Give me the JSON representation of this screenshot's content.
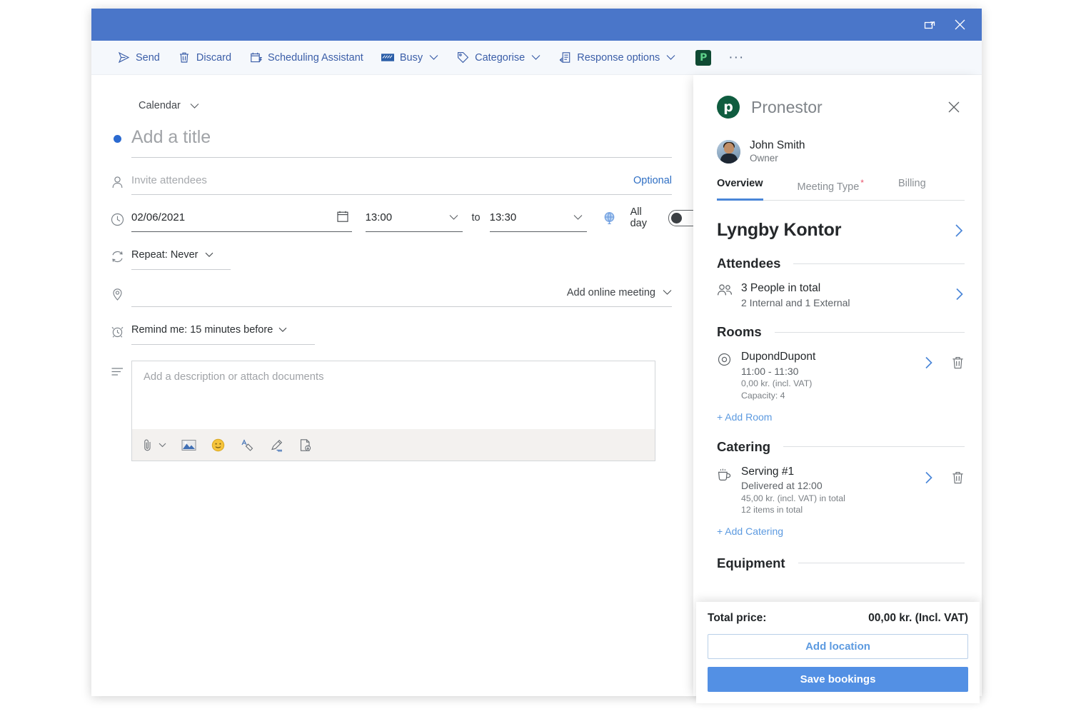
{
  "window": {
    "titlebar": {
      "popout_icon": "popout-icon",
      "close_icon": "close-icon"
    },
    "toolbar": {
      "items": [
        {
          "label": "Send",
          "icon": "send-icon",
          "chevron": false
        },
        {
          "label": "Discard",
          "icon": "trash-icon",
          "chevron": false
        },
        {
          "label": "Scheduling Assistant",
          "icon": "calendar-assistant-icon",
          "chevron": false
        },
        {
          "label": "Busy",
          "icon": "busy-icon",
          "chevron": true
        },
        {
          "label": "Categorise",
          "icon": "tag-icon",
          "chevron": true
        },
        {
          "label": "Response options",
          "icon": "response-options-icon",
          "chevron": true
        }
      ],
      "pronestor_badge": "P",
      "overflow": "···"
    }
  },
  "form": {
    "calendar_select": "Calendar",
    "title_placeholder": "Add a title",
    "attendees_placeholder": "Invite attendees",
    "optional_label": "Optional",
    "date_value": "02/06/2021",
    "start_time": "13:00",
    "to_label": "to",
    "end_time": "13:30",
    "all_day_label": "All day",
    "repeat_label": "Repeat:  Never",
    "online_meeting_label": "Add online meeting",
    "remind_label": "Remind me:  15 minutes before",
    "description_placeholder": "Add a description or attach documents",
    "desc_toolbar_icons": [
      "attach-icon",
      "insert-picture-icon",
      "emoji-icon",
      "signature-icon",
      "ink-icon",
      "export-icon"
    ]
  },
  "panel": {
    "brand_name": "Pronestor",
    "brand_initial": "p",
    "close_icon": "close-icon",
    "user": {
      "name": "John Smith",
      "role": "Owner"
    },
    "tabs": [
      {
        "label": "Overview",
        "active": true,
        "required": false
      },
      {
        "label": "Meeting Type",
        "active": false,
        "required": true
      },
      {
        "label": "Billing",
        "active": false,
        "required": false
      }
    ],
    "location_title": "Lyngby Kontor",
    "sections": {
      "attendees": {
        "heading": "Attendees",
        "item": {
          "line1": "3 People in total",
          "line2": "2 Internal and 1 External"
        }
      },
      "rooms": {
        "heading": "Rooms",
        "item": {
          "line1": "DupondDupont",
          "line2": "11:00 - 11:30",
          "line3": "0,00 kr. (incl. VAT)",
          "line4": "Capacity: 4"
        },
        "add_link": "+ Add Room"
      },
      "catering": {
        "heading": "Catering",
        "item": {
          "line1": "Serving #1",
          "line2": "Delivered at 12:00",
          "line3": "45,00 kr. (incl. VAT) in total",
          "line4": "12 items in total"
        },
        "add_link": "+ Add Catering"
      },
      "equipment": {
        "heading": "Equipment"
      }
    }
  },
  "footer": {
    "total_label": "Total price:",
    "total_value": "00,00 kr. (Incl. VAT)",
    "add_location_label": "Add location",
    "save_bookings_label": "Save bookings"
  },
  "colors": {
    "titlebar_blue": "#4a76c9",
    "toolbar_text_blue": "#3b5ea8",
    "accent_blue": "#5390e4",
    "link_blue": "#5c9ae0",
    "brand_green": "#0f5c3f",
    "required_red": "#e8516a"
  }
}
